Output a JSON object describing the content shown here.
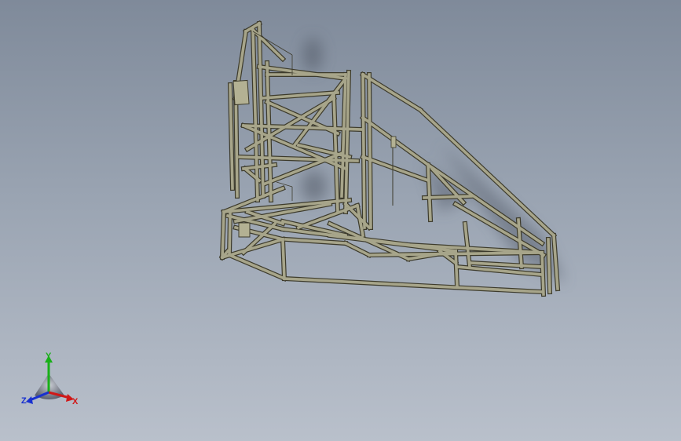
{
  "viewport": {
    "background_top": "#7f8a9a",
    "background_bottom": "#b9c0cb",
    "model": {
      "name": "tube-chassis-frame",
      "tube_fill": "#a7a58a",
      "tube_edge": "#3d3b2c",
      "shadow_color": "#5a6270"
    }
  },
  "triad": {
    "x_label": "X",
    "y_label": "Y",
    "z_label": "Z",
    "x_color": "#d01818",
    "y_color": "#18b018",
    "z_color": "#1830d0"
  }
}
